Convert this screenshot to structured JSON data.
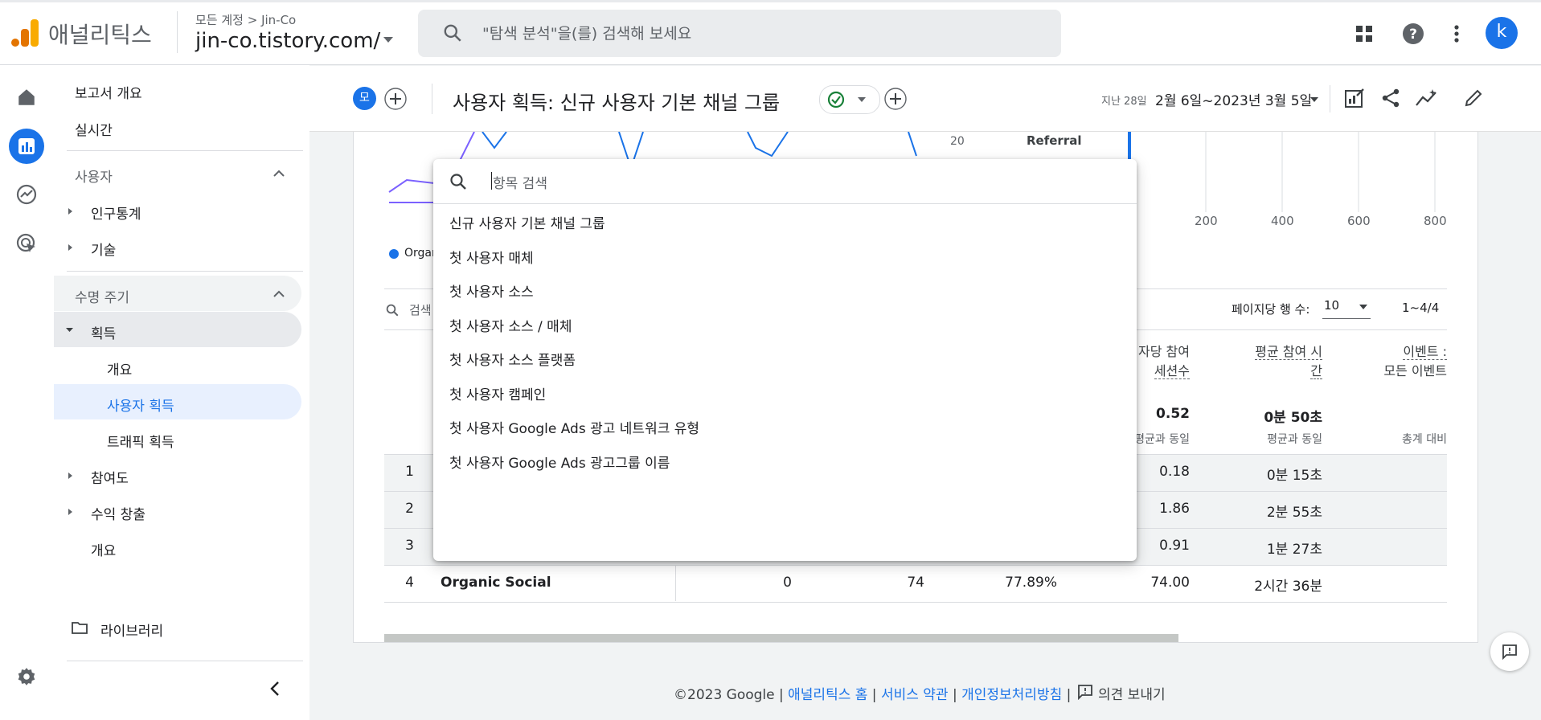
{
  "header": {
    "brand": "애널리틱스",
    "breadcrumb": "모든 계정 > Jin-Co",
    "account": "jin-co.tistory.com/",
    "search_placeholder": "\"탐색 분석\"을(를) 검색해 보세요",
    "avatar_letter": "k"
  },
  "sidebar": {
    "report_overview": "보고서 개요",
    "realtime": "실시간",
    "user_section": "사용자",
    "demographics": "인구통계",
    "tech": "기술",
    "lifecycle_section": "수명 주기",
    "acquisition": "획득",
    "acq_overview": "개요",
    "user_acquisition": "사용자 획득",
    "traffic_acquisition": "트래픽 획득",
    "engagement": "참여도",
    "monetization": "수익 창출",
    "overview": "개요",
    "library": "라이브러리"
  },
  "titlebar": {
    "chip": "모",
    "title": "사용자 획득: 신규 사용자 기본 채널 그룹",
    "range_label": "지난 28일",
    "range": "2월 6일~2023년 3월 5일"
  },
  "chart_bg": {
    "y_tick": "20",
    "bar_label": "Referral",
    "x_ticks": [
      "200",
      "400",
      "600",
      "800"
    ],
    "legend": "Organ"
  },
  "table": {
    "search_label": "검색",
    "rows_per_page_label": "페이지당 행 수:",
    "rows_per_page": "10",
    "pagination": "1~4/4",
    "col_sessions_per_user_1": "자당 참여",
    "col_sessions_per_user_2": "세션수",
    "col_avg_engagement_1": "평균 참여 시",
    "col_avg_engagement_2": "간",
    "col_events_1": "이벤트 :",
    "col_events_2": "모든 이벤트",
    "total_sessions_per_user": "0.52",
    "total_avg_engagement": "0분 50초",
    "total_sub_1": "평균과 동일",
    "total_sub_2": "평균과 동일",
    "total_sub_3": "총계 대비",
    "rows": [
      {
        "idx": "1",
        "channel": "",
        "c1": "",
        "c2": "",
        "c3": "",
        "spu": "0.18",
        "avg": "0분 15초"
      },
      {
        "idx": "2",
        "channel": "",
        "c1": "",
        "c2": "",
        "c3": "",
        "spu": "1.86",
        "avg": "2분 55초"
      },
      {
        "idx": "3",
        "channel": "",
        "c1": "",
        "c2": "",
        "c3": "",
        "spu": "0.91",
        "avg": "1분 27초"
      },
      {
        "idx": "4",
        "channel": "Organic Social",
        "c1": "0",
        "c2": "74",
        "c3": "77.89%",
        "spu": "74.00",
        "avg": "2시간 36분"
      }
    ]
  },
  "dialog": {
    "search_placeholder": "항목 검색",
    "options": [
      "신규 사용자 기본 채널 그룹",
      "첫 사용자 매체",
      "첫 사용자 소스",
      "첫 사용자 소스 / 매체",
      "첫 사용자 소스 플랫폼",
      "첫 사용자 캠페인",
      "첫 사용자 Google Ads 광고 네트워크 유형",
      "첫 사용자 Google Ads 광고그룹 이름"
    ]
  },
  "footer": {
    "copyright": "©2023 Google |",
    "analytics_home": "애널리틱스 홈",
    "terms": "서비스 약관",
    "privacy": "개인정보처리방침",
    "feedback": "의견 보내기"
  },
  "colors": {
    "accent": "#1a73e8",
    "success": "#188038"
  }
}
